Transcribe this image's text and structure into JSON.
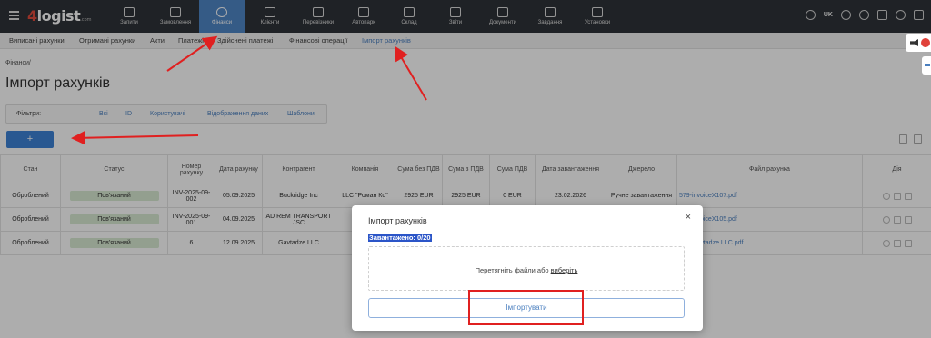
{
  "app": {
    "logo_digit": "4",
    "logo_text": "logist",
    "logo_domain": ".com"
  },
  "nav": {
    "items": [
      {
        "label": "Запити",
        "icon": "chat-icon"
      },
      {
        "label": "Замовлення",
        "icon": "box-icon"
      },
      {
        "label": "Фінанси",
        "icon": "money-bag-icon",
        "active": true
      },
      {
        "label": "Клієнти",
        "icon": "users-icon"
      },
      {
        "label": "Перевізники",
        "icon": "truck-icon"
      },
      {
        "label": "Автопарк",
        "icon": "trailer-icon"
      },
      {
        "label": "Склад",
        "icon": "warehouse-icon"
      },
      {
        "label": "Звіти",
        "icon": "chart-icon"
      },
      {
        "label": "Документи",
        "icon": "document-icon"
      },
      {
        "label": "Завдання",
        "icon": "calendar-icon"
      },
      {
        "label": "Установки",
        "icon": "gear-icon"
      }
    ],
    "language": "UK"
  },
  "subnav": {
    "items": [
      {
        "label": "Виписані рахунки"
      },
      {
        "label": "Отримані рахунки"
      },
      {
        "label": "Акти"
      },
      {
        "label": "Платежі"
      },
      {
        "label": "Здійснені платежі"
      },
      {
        "label": "Фінансові операції"
      },
      {
        "label": "Імпорт рахунків",
        "active": true
      }
    ]
  },
  "breadcrumb": "Фінанси/",
  "page_title": "Імпорт рахунків",
  "filters": {
    "label": "Фільтри:",
    "options": [
      "Всі",
      "ID",
      "Користувачі",
      "Відображення даних",
      "Шаблони"
    ]
  },
  "add_button": "+",
  "table": {
    "headers": [
      "Стан",
      "Статус",
      "Номер рахунку",
      "Дата рахунку",
      "Контрагент",
      "Компанія",
      "Сума без ПДВ",
      "Сума з ПДВ",
      "Сума ПДВ",
      "Дата завантаження",
      "Джерело",
      "Файл рахунка",
      "Дія"
    ],
    "rows": [
      {
        "state": "Оброблений",
        "status": "Пов'язаний",
        "number": "INV-2025-09-002",
        "date": "05.09.2025",
        "counterparty": "Buckridge Inc",
        "company": "LLC \"Роман Ко\"",
        "sum_no_vat": "2925 EUR",
        "sum_vat": "2925 EUR",
        "vat": "0 EUR",
        "upload_date": "23.02.2026",
        "source": "Ручне завантаження",
        "file": "579-invoiceX107.pdf"
      },
      {
        "state": "Оброблений",
        "status": "Пов'язаний",
        "number": "INV-2025-09-001",
        "date": "04.09.2025",
        "counterparty": "AD REM TRANSPORT JSC",
        "company": "",
        "sum_no_vat": "",
        "sum_vat": "",
        "vat": "",
        "upload_date": "",
        "source": "",
        "file": "834-invoiceX105.pdf"
      },
      {
        "state": "Оброблений",
        "status": "Пов'язаний",
        "number": "6",
        "date": "12.09.2025",
        "counterparty": "Gavtadze LLC",
        "company": "",
        "sum_no_vat": "",
        "sum_vat": "",
        "vat": "",
        "upload_date": "",
        "source": "",
        "file": "578-Gavtadze LLC.pdf"
      }
    ]
  },
  "modal": {
    "title": "Імпорт рахунків",
    "close": "×",
    "loaded": "Завантажено: 0/20",
    "drop_text": "Перетягніть файли або ",
    "drop_link": "виберіть",
    "import_button": "Імпортувати"
  },
  "colors": {
    "nav_bg": "#2f3338",
    "accent": "#4f86c6",
    "badge_bg": "#d9ead3",
    "annotation_red": "#e02020"
  }
}
